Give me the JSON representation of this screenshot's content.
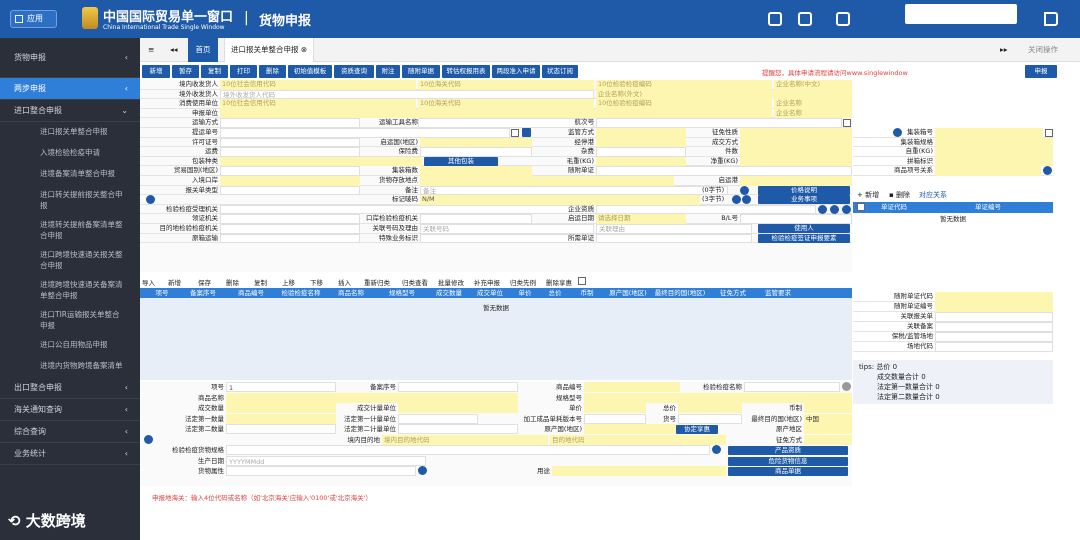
{
  "header": {
    "app_label": "应用",
    "brand_cn": "中国国际贸易单一窗口",
    "brand_en": "China International Trade Single Window",
    "separator": "|",
    "module_title": "货物申报"
  },
  "sidebar": {
    "top": "货物申报",
    "items": [
      {
        "label": "两步申报",
        "level": 1,
        "active": true,
        "arrow": "‹"
      },
      {
        "label": "进口整合申报",
        "level": 1,
        "arrow": "⌄"
      },
      {
        "label": "进口报关单整合申报",
        "level": 2
      },
      {
        "label": "入境检验检疫申请",
        "level": 2
      },
      {
        "label": "进境备案清单整合申报",
        "level": 2
      },
      {
        "label": "进口转关提前报关整合申报",
        "level": 2
      },
      {
        "label": "进境转关提前备案清单整合申报",
        "level": 2
      },
      {
        "label": "进口跨境快速通关报关整合申报",
        "level": 2
      },
      {
        "label": "进境跨境快速通关备案清单整合申报",
        "level": 2
      },
      {
        "label": "进口TIR运输报关单整合申报",
        "level": 2
      },
      {
        "label": "进口公自用物品申报",
        "level": 2
      },
      {
        "label": "进境内货物跨境备案清单",
        "level": 2
      },
      {
        "label": "出口整合申报",
        "level": 1,
        "arrow": "‹"
      },
      {
        "label": "海关通知查询",
        "level": 1,
        "arrow": "‹"
      },
      {
        "label": "综合查询",
        "level": 1,
        "arrow": "‹"
      },
      {
        "label": "业务统计",
        "level": 1,
        "arrow": "‹"
      }
    ]
  },
  "tabs": {
    "menu_icon": "≡",
    "back_icon": "◂◂",
    "home": "首页",
    "current": "进口报关单整合申报",
    "close": "⊗",
    "nav": "▸▸",
    "ops": "关闭操作"
  },
  "toolbar": {
    "buttons": [
      "新增",
      "暂存",
      "复制",
      "打印",
      "删除",
      "初始值模板",
      "资质查询",
      "附注",
      "随附单据",
      "转估权报用表",
      "两段准入申请",
      "状态订阅"
    ],
    "warning": "提醒您，具体申请流程请访问www.singlewindow",
    "declare": "申报"
  },
  "form": {
    "r1": {
      "a": "境内收发货人",
      "b": "10位社会信用代码",
      "c": "10位海关代码",
      "d": "10位检验检疫编码",
      "e": "企业名称(中文)"
    },
    "r2": {
      "a": "境外收发货人",
      "b": "境外收发货人代码",
      "e": "企业名称(外文)"
    },
    "r3": {
      "a": "消费使用单位",
      "b": "10位社会信用代码",
      "c": "10位海关代码",
      "d": "10位检验检疫编码",
      "e": "企业名称"
    },
    "r4": {
      "a": "申报单位",
      "e": "企业名称"
    },
    "r5": {
      "a": "运输方式",
      "b": "运输工具名称",
      "c": "航次号"
    },
    "r6": {
      "a": "提运单号",
      "b": "监管方式",
      "c": "征免性质"
    },
    "r7": {
      "a": "许可证号",
      "b": "启运国(地区)",
      "c": "经停港",
      "d": "成交方式"
    },
    "r8": {
      "a": "运费",
      "b": "保险费",
      "c": "杂费",
      "d": "件数"
    },
    "r9": {
      "a": "包装种类",
      "b": "其他包装",
      "c": "毛重(KG)",
      "d": "净重(KG)"
    },
    "r10": {
      "a": "贸易国别(地区)",
      "b": "集装箱数",
      "c": "随附单证"
    },
    "r11": {
      "a": "入境口岸",
      "b": "货物存放地点",
      "c": "启运港"
    },
    "r12": {
      "a": "报关单类型",
      "b": "备注",
      "bph": "备注",
      "bcnt": "(0字节)",
      "bbtn": "价格说明"
    },
    "r13": {
      "b": "标记唛码",
      "bval": "N/M",
      "bcnt": "(3字节)",
      "bbtn": "业务事项"
    },
    "r14": {
      "a": "检验检疫受理机关",
      "c": "企业资质"
    },
    "r15": {
      "a": "领证机关",
      "b": "口岸检验检疫机关",
      "c": "启运日期",
      "cph": "请选择日期",
      "d": "B/L号"
    },
    "r16": {
      "a": "目的地检验检疫机关",
      "b": "关联号码及理由",
      "bph": "关联号码",
      "cph": "关联理由",
      "btn": "使用人"
    },
    "r17": {
      "a": "原箱运输",
      "b": "特殊业务标识",
      "c": "所需单证",
      "btn": "检验检疫签证申报要素"
    }
  },
  "right_panel": {
    "q": "?",
    "r1": "集装箱号",
    "r2": "集装箱规格",
    "r3": "自重(KG)",
    "r4": "拼箱标识",
    "r5": "商品项号关系",
    "add": "新增",
    "del": "删除",
    "rel": "对应关系",
    "col1": "单证代码",
    "col2": "单证编号",
    "nodata": "暂无数据"
  },
  "grid": {
    "toolbar": [
      "导入",
      "新增",
      "保存",
      "删除",
      "复制",
      "上移",
      "下移",
      "插入",
      "重新归类",
      "归类查看",
      "批量修改",
      "补充申报",
      "归类先例",
      "删除享惠"
    ],
    "columns": [
      "项号",
      "备案序号",
      "商品编号",
      "检验检疫名称",
      "商品名称",
      "规格型号",
      "成交数量",
      "成交单位",
      "单价",
      "总价",
      "币制",
      "原产国(地区)",
      "最终目的国(地区)",
      "征免方式",
      "监管要求"
    ],
    "nodata": "暂无数据"
  },
  "right_panel2": {
    "r1": "随附单证代码",
    "r2": "随附单证编号",
    "r3": "关联报关单",
    "r4": "关联备案",
    "r5": "保税/监管场地",
    "r6": "场地代码",
    "tips": "tips: 总价 0",
    "t1": "成交数量合计 0",
    "t2": "法定第一数量合计 0",
    "t3": "法定第二数量合计 0"
  },
  "item": {
    "a1": "项号",
    "a1v": "1",
    "a2": "备案序号",
    "a3": "商品编号",
    "a4": "检验检疫名称",
    "b1": "商品名称",
    "b2": "规格型号",
    "c1": "成交数量",
    "c2": "成交计量单位",
    "c3": "单价",
    "c4": "总价",
    "c5": "币制",
    "d1": "法定第一数量",
    "d2": "法定第一计量单位",
    "d3": "加工成品单耗版本号",
    "d4": "货号",
    "d5": "最终目的国(地区)",
    "d5v": "中国",
    "e1": "法定第二数量",
    "e2": "法定第二计量单位",
    "e3": "原产国(地区)",
    "e4": "原产地区",
    "f1": "境内目的地",
    "f1ph": "境内目的地代码",
    "f1ph2": "目的地代码",
    "f2": "协定享惠",
    "f3": "征免方式",
    "g1": "检验检疫货物规格",
    "g2": "产品资质",
    "h1": "生产日期",
    "h1ph": "YYYYMMdd",
    "h2": "危险货物信息",
    "i1": "货物属性",
    "i2": "用途",
    "i3": "商品单据"
  },
  "note": "申报地海关：输入4位代码或名称（如'北京海关'应输入'0100'或'北京海关'）",
  "watermark": "大数跨境"
}
